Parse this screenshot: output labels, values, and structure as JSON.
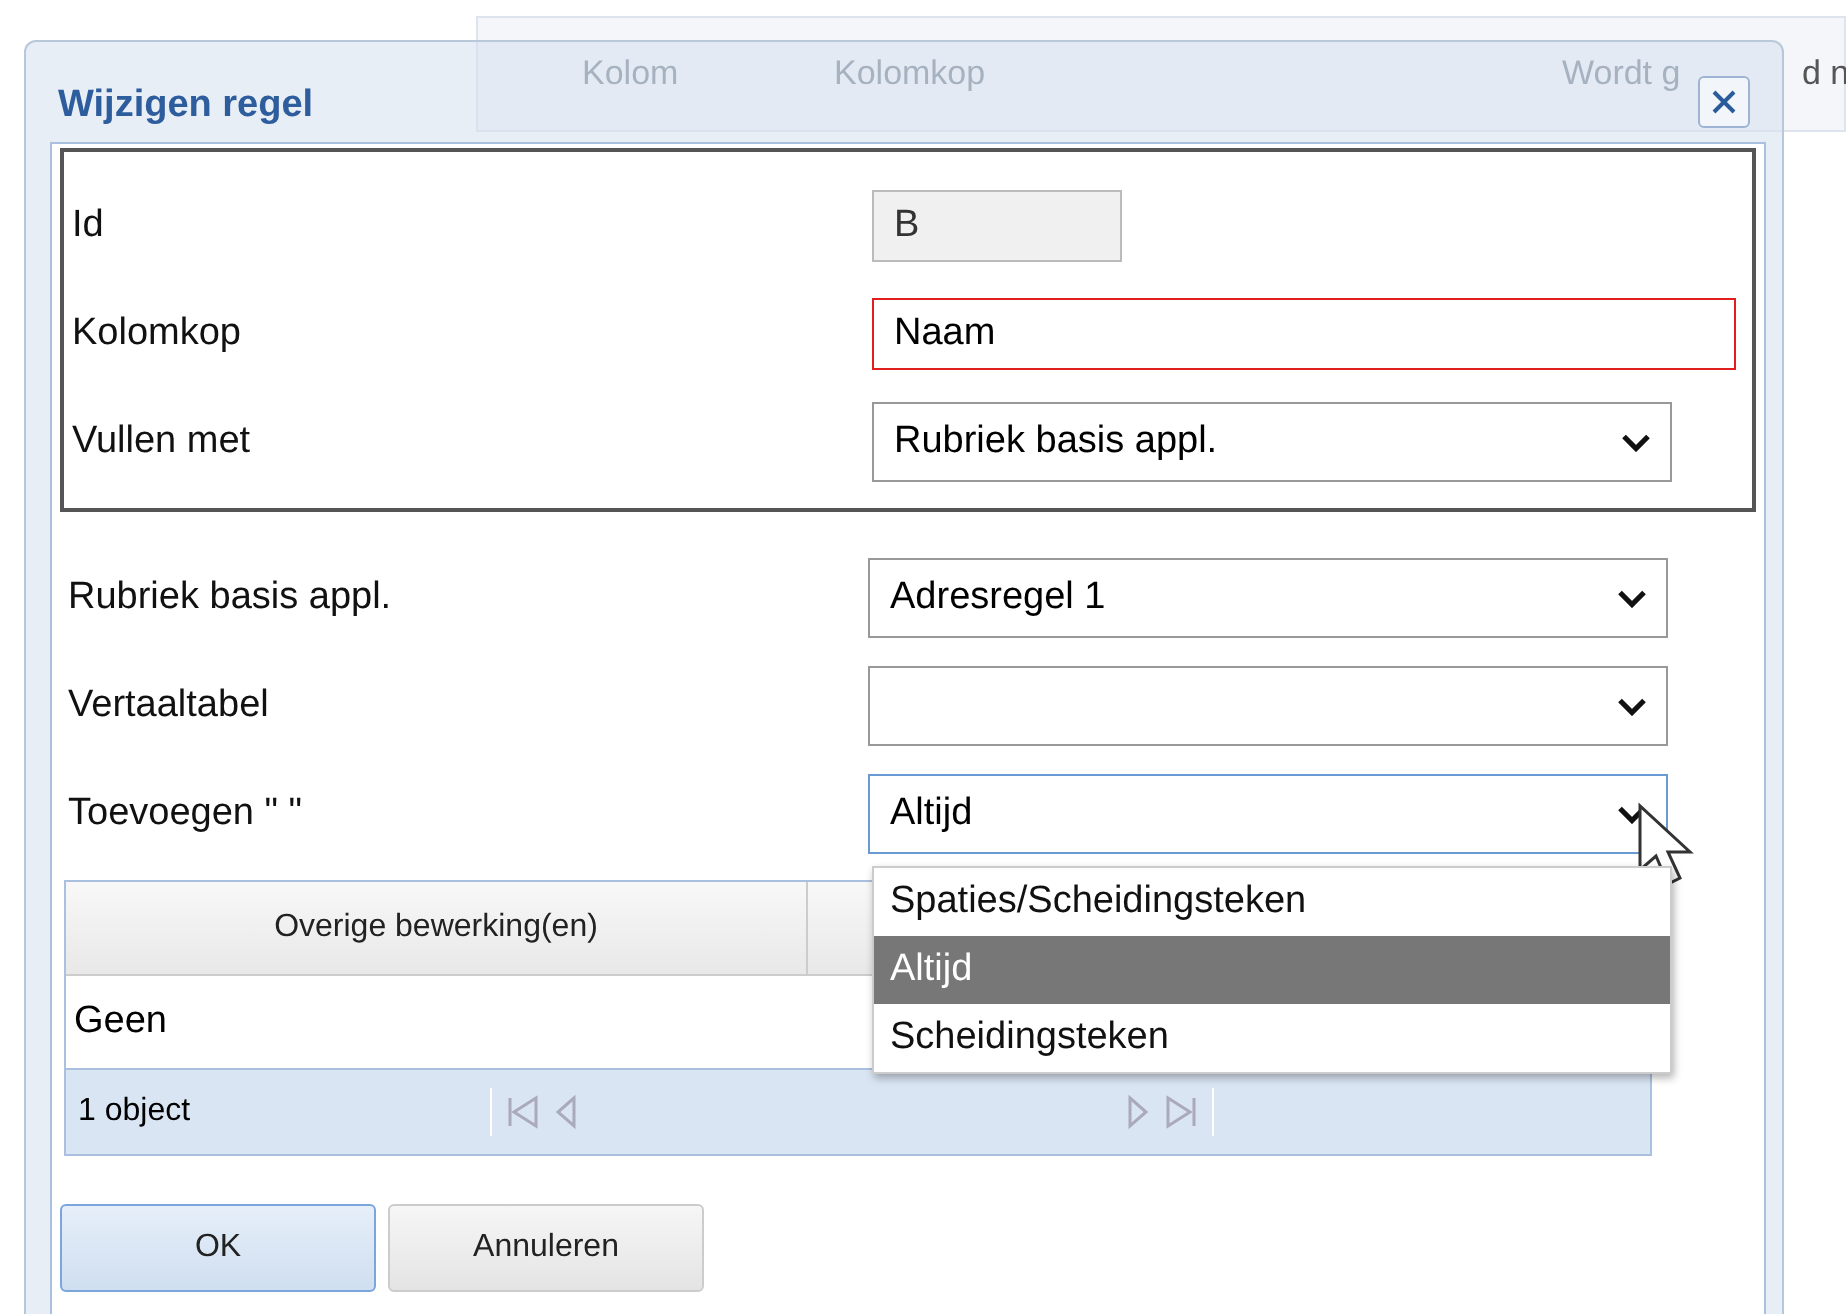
{
  "background_table": {
    "columns": [
      "Kolom",
      "Kolomkop",
      "Wordt g",
      "d n"
    ]
  },
  "dialog": {
    "title": "Wijzigen regel"
  },
  "fieldset": [
    {
      "label": "Id",
      "kind": "text",
      "value": "B",
      "readonly": true,
      "invalid": false
    },
    {
      "label": "Kolomkop",
      "kind": "text",
      "value": "Naam",
      "readonly": false,
      "invalid": true
    },
    {
      "label": "Vullen met",
      "kind": "select",
      "value": "Rubriek basis appl.",
      "open": false
    }
  ],
  "fields": [
    {
      "label": "Rubriek basis appl.",
      "kind": "select",
      "value": "Adresregel 1",
      "open": false
    },
    {
      "label": "Vertaaltabel",
      "kind": "select",
      "open": false
    },
    {
      "label": "Toevoegen \" \"",
      "kind": "select",
      "value": "Altijd",
      "open": true,
      "options": [
        {
          "label": "Spaties/Scheidingsteken",
          "selected": false
        },
        {
          "label": "Altijd",
          "selected": true
        },
        {
          "label": "Scheidingsteken",
          "selected": false
        }
      ]
    }
  ],
  "grid": {
    "columns": [
      "Overige bewerking(en)"
    ],
    "rows": [
      [
        "Geen"
      ]
    ],
    "pager": "1 object"
  },
  "buttons": [
    {
      "label": "OK",
      "default": true
    },
    {
      "label": "Annuleren",
      "default": false
    }
  ]
}
